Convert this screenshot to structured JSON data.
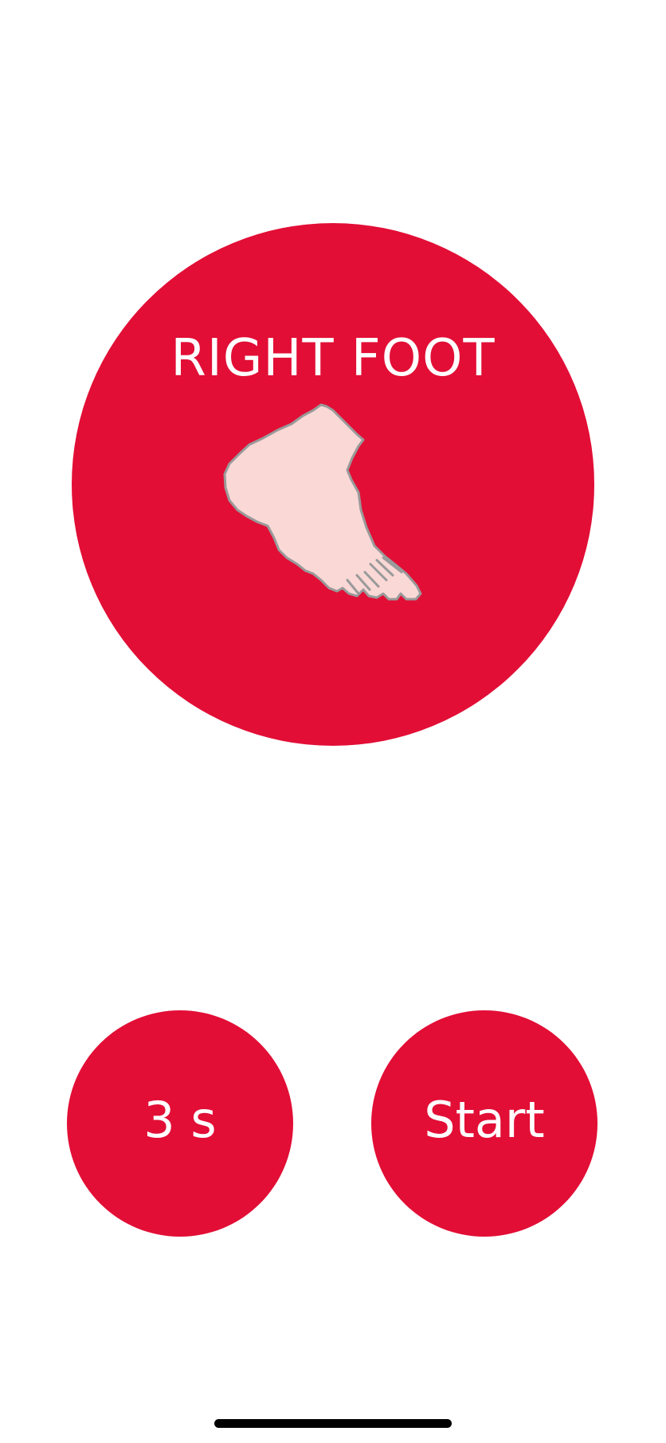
{
  "exercise": {
    "title": "RIGHT FOOT",
    "illustration": "right-foot-illustration",
    "accent_color": "#e20e36"
  },
  "controls": {
    "duration_label": "3 s",
    "start_label": "Start"
  }
}
